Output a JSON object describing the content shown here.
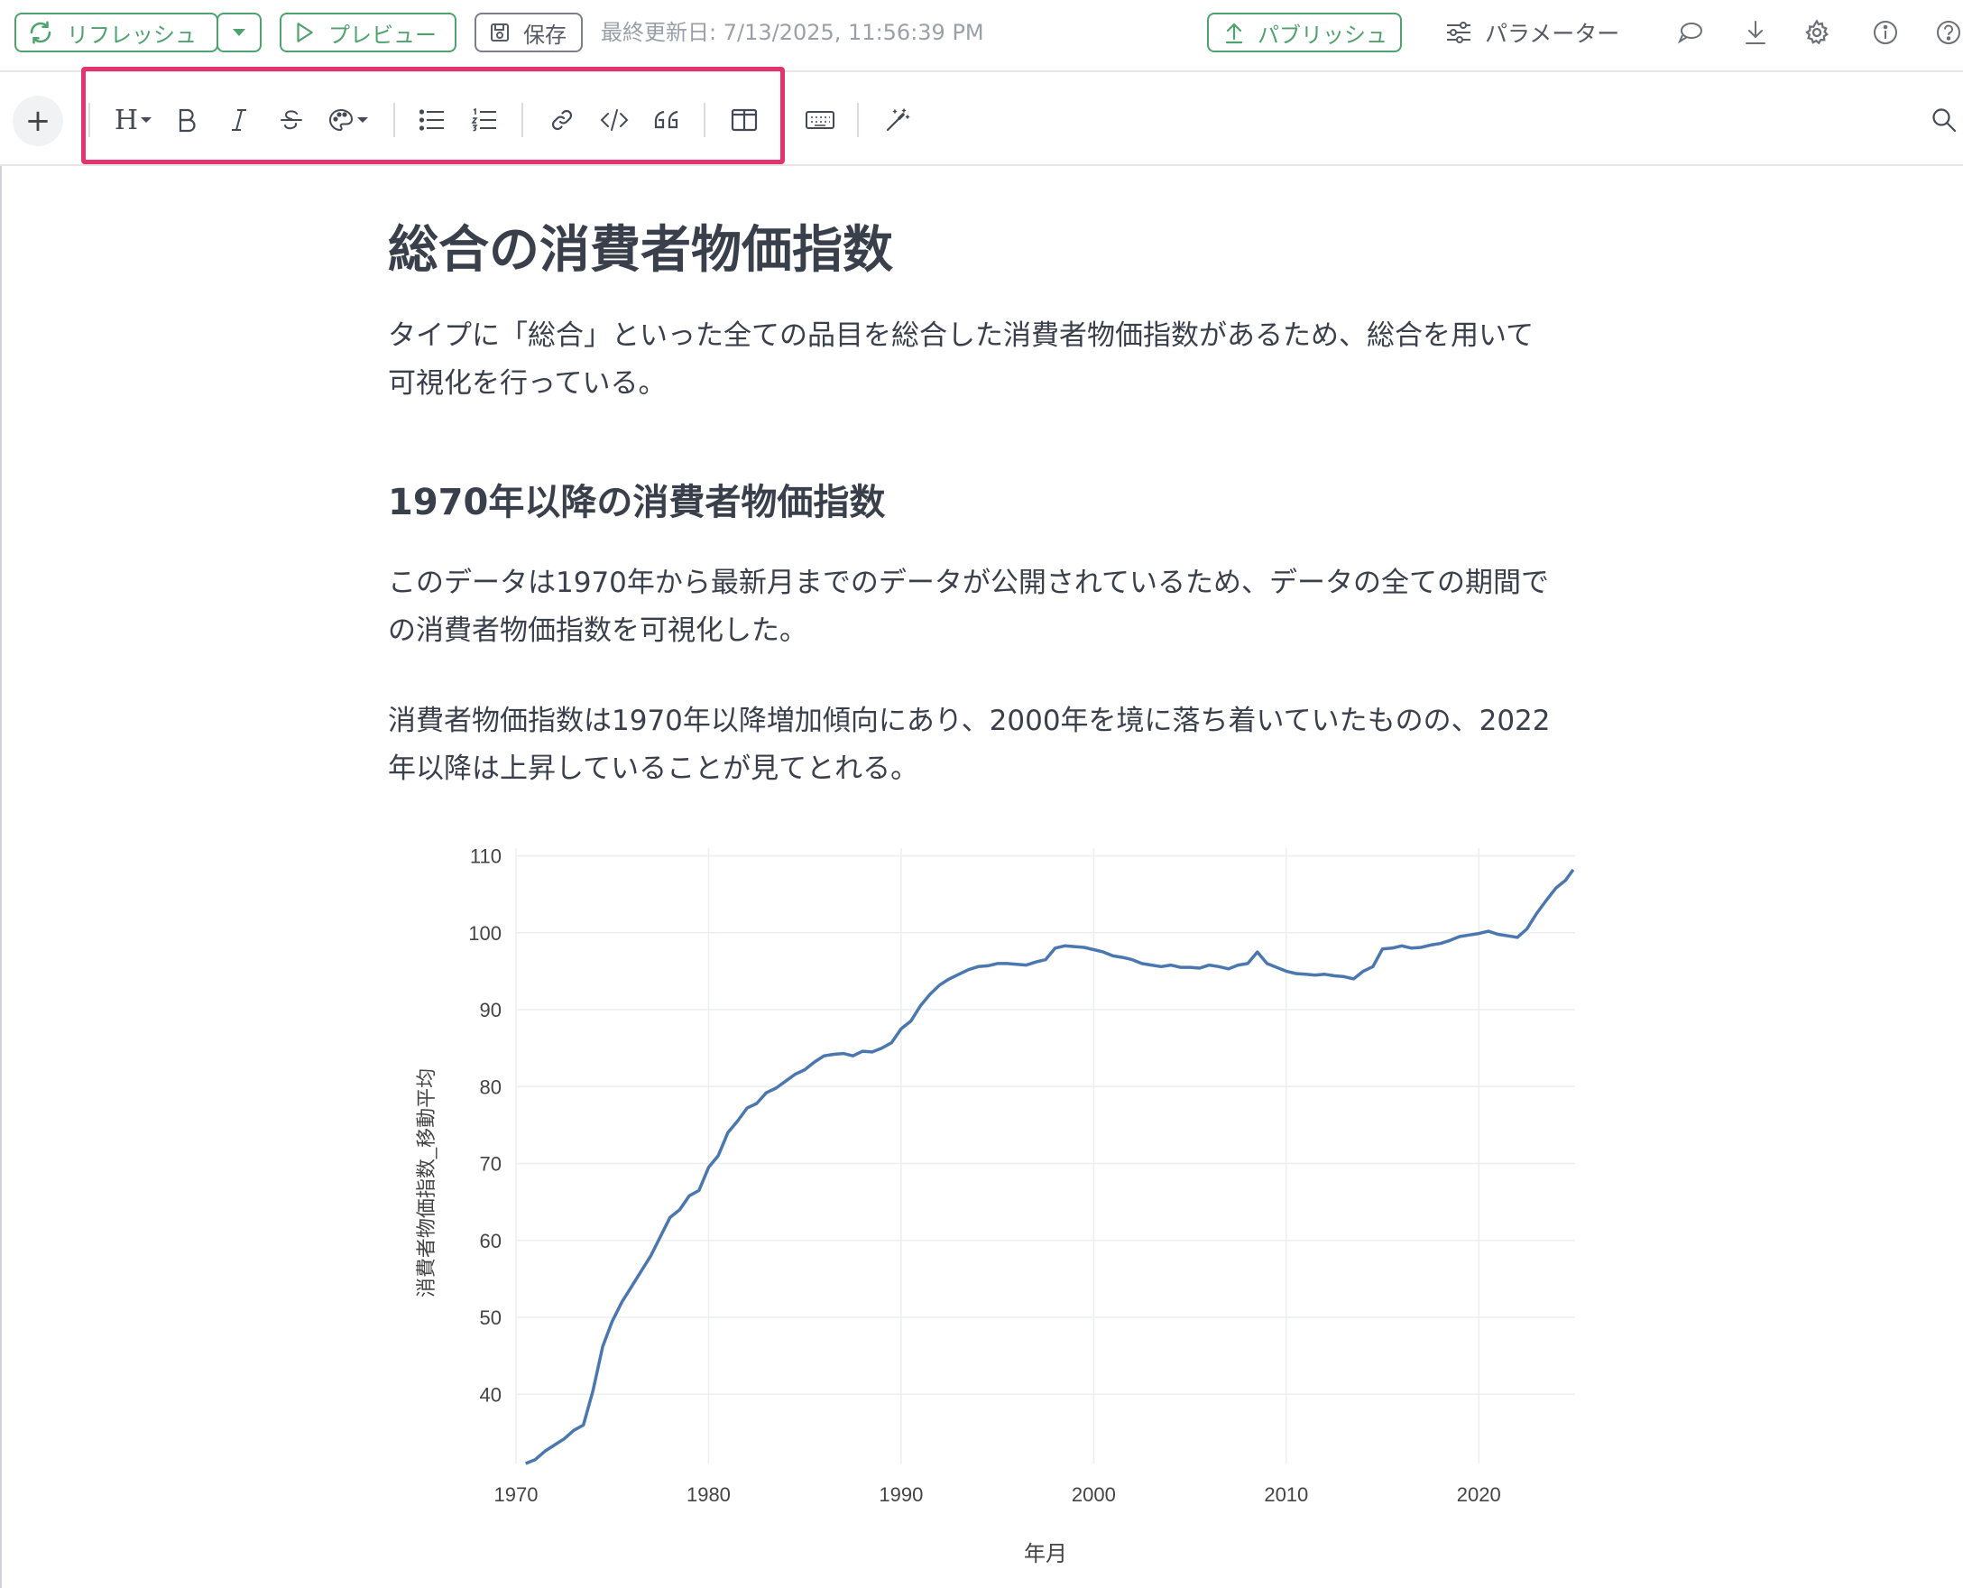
{
  "topbar": {
    "refresh_label": "リフレッシュ",
    "preview_label": "プレビュー",
    "save_label": "保存",
    "last_updated": "最終更新日: 7/13/2025, 11:56:39 PM",
    "publish_label": "パブリッシュ",
    "parameters_label": "パラメーター"
  },
  "toolbar": {
    "add_label": "+",
    "heading_label": "H"
  },
  "content": {
    "title": "総合の消費者物価指数",
    "para1_line1": "タイプに「総合」といった全ての品目を総合した消費者物価指数があるため、総合を用いて",
    "para1_line2": "可視化を行っている。",
    "subtitle": "1970年以降の消費者物価指数",
    "para2_line1": "このデータは1970年から最新月までのデータが公開されているため、データの全ての期間で",
    "para2_line2": "の消費者物価指数を可視化した。",
    "para3_line1": "消費者物価指数は1970年以降増加傾向にあり、2000年を境に落ち着いていたものの、2022",
    "para3_line2": "年以降は上昇していることが見てとれる。"
  },
  "colors": {
    "accent_green": "#4fa26d",
    "highlight_pink": "#e5336d",
    "line_blue": "#4a77b0"
  },
  "chart_data": {
    "type": "line",
    "xlabel": "年月",
    "ylabel": "消費者物価指数_移動平均",
    "xlim": [
      1970,
      2025
    ],
    "ylim": [
      31,
      111
    ],
    "x_ticks": [
      1970,
      1980,
      1990,
      2000,
      2010,
      2020
    ],
    "y_ticks": [
      40,
      50,
      60,
      70,
      80,
      90,
      100,
      110
    ],
    "grid": true,
    "series": [
      {
        "x": [
          1970.5,
          1971,
          1971.5,
          1972,
          1972.5,
          1973,
          1973.5,
          1974,
          1974.5,
          1975,
          1975.5,
          1976,
          1976.5,
          1977,
          1977.5,
          1978,
          1978.5,
          1979,
          1979.5,
          1980,
          1980.5,
          1981,
          1981.5,
          1982,
          1982.5,
          1983,
          1983.5,
          1984,
          1984.5,
          1985,
          1985.5,
          1986,
          1986.5,
          1987,
          1987.5,
          1988,
          1988.5,
          1989,
          1989.5,
          1990,
          1990.5,
          1991,
          1991.5,
          1992,
          1992.5,
          1993,
          1993.5,
          1994,
          1994.5,
          1995,
          1995.5,
          1996,
          1996.5,
          1997,
          1997.5,
          1998,
          1998.5,
          1999,
          1999.5,
          2000,
          2000.5,
          2001,
          2001.5,
          2002,
          2002.5,
          2003,
          2003.5,
          2004,
          2004.5,
          2005,
          2005.5,
          2006,
          2006.5,
          2007,
          2007.5,
          2008,
          2008.5,
          2009,
          2009.5,
          2010,
          2010.5,
          2011,
          2011.5,
          2012,
          2012.5,
          2013,
          2013.5,
          2014,
          2014.5,
          2015,
          2015.5,
          2016,
          2016.5,
          2017,
          2017.5,
          2018,
          2018.5,
          2019,
          2019.5,
          2020,
          2020.5,
          2021,
          2021.5,
          2022,
          2022.5,
          2023,
          2023.5,
          2024,
          2024.5,
          2024.9
        ],
        "values": [
          31.0,
          31.5,
          32.6,
          33.4,
          34.2,
          35.3,
          36.0,
          40.5,
          46.2,
          49.5,
          52.0,
          54.0,
          56.0,
          58.0,
          60.5,
          63.0,
          64.0,
          65.8,
          66.5,
          69.5,
          71.0,
          74.0,
          75.5,
          77.2,
          77.8,
          79.2,
          79.8,
          80.7,
          81.6,
          82.2,
          83.2,
          84.0,
          84.2,
          84.3,
          84.0,
          84.6,
          84.5,
          85.0,
          85.7,
          87.5,
          88.5,
          90.5,
          92.0,
          93.2,
          94.0,
          94.6,
          95.2,
          95.6,
          95.7,
          96.0,
          96.0,
          95.9,
          95.8,
          96.2,
          96.5,
          98.0,
          98.3,
          98.2,
          98.1,
          97.8,
          97.5,
          97.0,
          96.8,
          96.5,
          96.0,
          95.8,
          95.6,
          95.8,
          95.5,
          95.5,
          95.4,
          95.8,
          95.6,
          95.3,
          95.8,
          96.0,
          97.5,
          96.0,
          95.5,
          95.0,
          94.7,
          94.6,
          94.5,
          94.6,
          94.4,
          94.3,
          94.0,
          95.0,
          95.6,
          97.9,
          98.0,
          98.3,
          98.0,
          98.1,
          98.4,
          98.6,
          99.0,
          99.5,
          99.7,
          99.9,
          100.2,
          99.8,
          99.6,
          99.4,
          100.5,
          102.5,
          104.2,
          105.8,
          106.8,
          108.2
        ]
      }
    ]
  }
}
